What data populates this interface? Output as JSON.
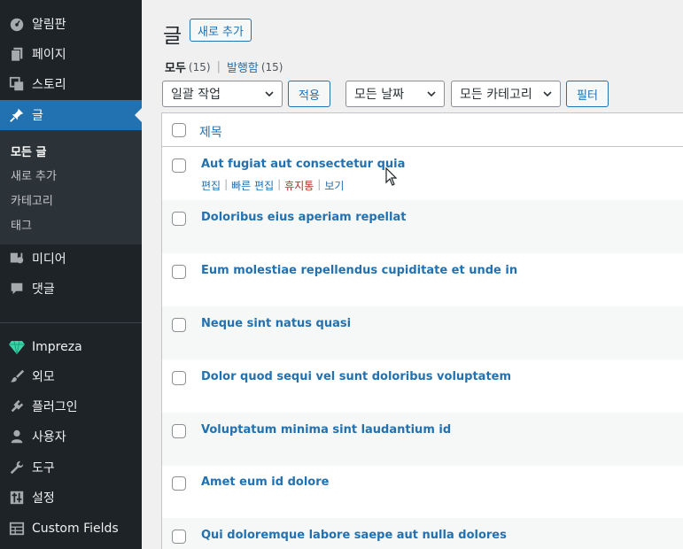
{
  "sidebar": {
    "items": [
      {
        "label": "알림판",
        "icon": "dashboard-icon"
      },
      {
        "label": "페이지",
        "icon": "pages-icon"
      },
      {
        "label": "스토리",
        "icon": "stories-icon"
      },
      {
        "label": "글",
        "icon": "pin-icon"
      },
      {
        "label": "미디어",
        "icon": "media-icon"
      },
      {
        "label": "댓글",
        "icon": "comment-icon"
      },
      {
        "label": "Impreza",
        "icon": "diamond-icon"
      },
      {
        "label": "외모",
        "icon": "brush-icon"
      },
      {
        "label": "플러그인",
        "icon": "plugin-icon"
      },
      {
        "label": "사용자",
        "icon": "user-icon"
      },
      {
        "label": "도구",
        "icon": "wrench-icon"
      },
      {
        "label": "설정",
        "icon": "settings-icon"
      },
      {
        "label": "Custom Fields",
        "icon": "table-icon"
      }
    ],
    "submenu": [
      "모든 글",
      "새로 추가",
      "카테고리",
      "태그"
    ]
  },
  "header": {
    "title": "글",
    "add_new": "새로 추가"
  },
  "filters_links": {
    "all_label": "모두",
    "all_count": "(15)",
    "published_label": "발행함",
    "published_count": "(15)"
  },
  "toolbar": {
    "bulk_action": "일괄 작업",
    "apply": "적용",
    "date_filter": "모든 날짜",
    "category_filter": "모든 카테고리",
    "filter_button": "필터"
  },
  "table": {
    "column_title": "제목",
    "row_actions": {
      "edit": "편집",
      "quick_edit": "빠른 편집",
      "trash": "휴지통",
      "view": "보기"
    },
    "rows": [
      "Aut fugiat aut consectetur quia",
      "Doloribus eius aperiam repellat",
      "Eum molestiae repellendus cupiditate et unde in",
      "Neque sint natus quasi",
      "Dolor quod sequi vel sunt doloribus voluptatem",
      "Voluptatum minima sint laudantium id",
      "Amet eum id dolore",
      "Qui doloremque labore saepe aut nulla dolores"
    ]
  },
  "colors": {
    "sidebar_bg": "#1d2327",
    "accent": "#2271b1",
    "trash": "#b32d2e"
  }
}
